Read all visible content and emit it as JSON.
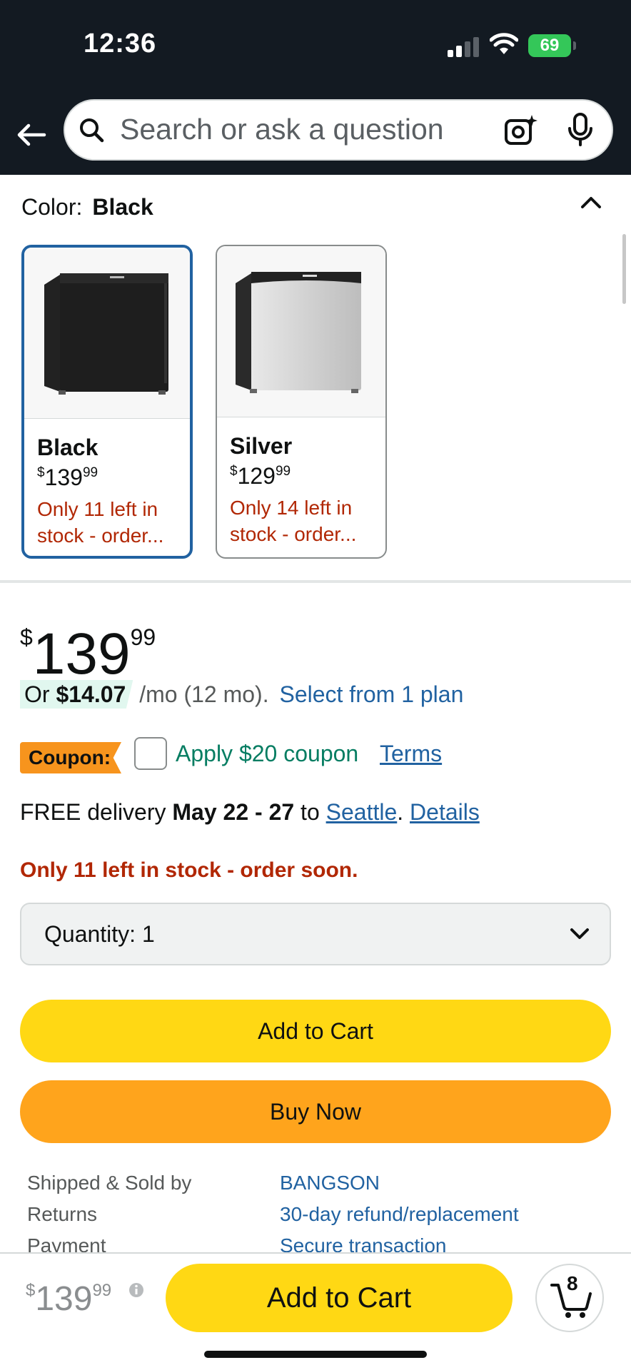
{
  "status": {
    "time": "12:36",
    "battery": "69"
  },
  "search": {
    "placeholder": "Search or ask a question"
  },
  "color_selector": {
    "label": "Color:",
    "selected": "Black",
    "options": [
      {
        "name": "Black",
        "price_dollars": "139",
        "price_cents": "99",
        "stock": "Only 11 left in stock - order..."
      },
      {
        "name": "Silver",
        "price_dollars": "129",
        "price_cents": "99",
        "stock": "Only 14 left in stock - order..."
      }
    ]
  },
  "price": {
    "currency": "$",
    "dollars": "139",
    "cents": "99"
  },
  "installment": {
    "prefix": "Or ",
    "amount": "$14.07",
    "suffix": " /mo (12 mo).",
    "plan_link": "Select from 1 plan"
  },
  "coupon": {
    "badge": "Coupon:",
    "text": "Apply $20 coupon",
    "terms": "Terms"
  },
  "delivery": {
    "free": "FREE delivery ",
    "dates": "May 22 - 27",
    "to": " to ",
    "location": "Seattle",
    "sep": ". ",
    "details": "Details"
  },
  "stock_warning": "Only 11 left in stock - order soon.",
  "quantity": {
    "label": "Quantity:",
    "value": "1"
  },
  "buttons": {
    "add_to_cart": "Add to Cart",
    "buy_now": "Buy Now"
  },
  "info": [
    {
      "key": "Shipped & Sold by",
      "value": "BANGSON"
    },
    {
      "key": "Returns",
      "value": "30-day refund/replacement"
    },
    {
      "key": "Payment",
      "value": "Secure transaction"
    }
  ],
  "bottom_bar": {
    "currency": "$",
    "dollars": "139",
    "cents": "99",
    "add_to_cart": "Add to Cart",
    "cart_count": "8"
  },
  "colors": {
    "nav_bg": "#131a22",
    "link": "#2162a1",
    "deal_red": "#b12704",
    "cart_yellow": "#ffd814",
    "buy_orange": "#ffa41c",
    "coupon_green": "#067d62"
  }
}
